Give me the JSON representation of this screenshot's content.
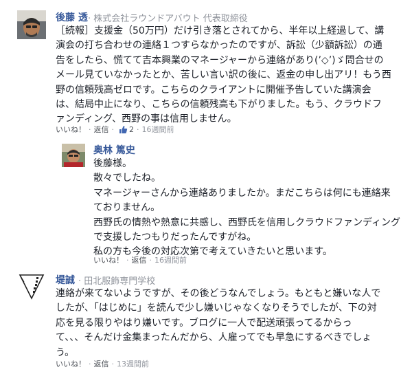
{
  "comments": [
    {
      "author": "後藤 透",
      "affiliation": "· 株式会社ラウンドアバウト 代表取締役",
      "lines": [
        "［続報］支援金（50万円）だけ引き落とされてから、半年以上経過して、講",
        "演会の打ち合わせの連絡１つすらなかったのですが、訴訟（少額訴訟）の通",
        "告をしたら、慌てて吉本興業のマネージャーから連絡があり(’◇’)ゞ問合せの",
        "メール見ていなかったとか、苦しい言い訳の後に、返金の申し出アリ！もう西",
        "野の信頼残高ゼロです。こちらのクライアントに開催予告していた講演会",
        "は、結局中止になり、こちらの信頼残高も下がりました。もう、クラウドフ",
        "ァンディング、西野の事は信用しません。"
      ],
      "like_label": "いいね！",
      "reply_label": "返信",
      "like_count": "2",
      "time": "16週間前",
      "dot": "·"
    },
    {
      "author": "奥林 篤史",
      "affiliation": "",
      "lines": [
        "後藤様。",
        "散々でしたね。",
        "マネージャーさんから連絡ありましたか。まだこちらは何にも連絡来",
        "ておりません。",
        "西野氏の情熱や熱意に共感し、西野氏を信用しクラウドファンディング",
        "で支援したつもりだったんですがね。",
        "私の方も今後の対応次第で考えていきたいと思います。"
      ],
      "like_label": "いいね！",
      "reply_label": "返信",
      "time": "16週間前",
      "dot": "·"
    },
    {
      "author": "堤誠",
      "affiliation": "· 田北服飾専門学校",
      "lines": [
        "連絡が来てないようですが、その後どうなんでしょう。もともと嫌いな人で",
        "したが、「はじめに」を読んで少し嫌いじゃなくなりそうでしたが、下の対",
        "応を見る限りやはり嫌いです。ブログに一人で配送頑張ってるからっ",
        "て、、、そんだけ金集まったんだから、人雇ってでも早急にするべきでしょ",
        "う。"
      ],
      "like_label": "いいね！",
      "reply_label": "返信",
      "time": "13週間前",
      "dot": "·"
    }
  ]
}
